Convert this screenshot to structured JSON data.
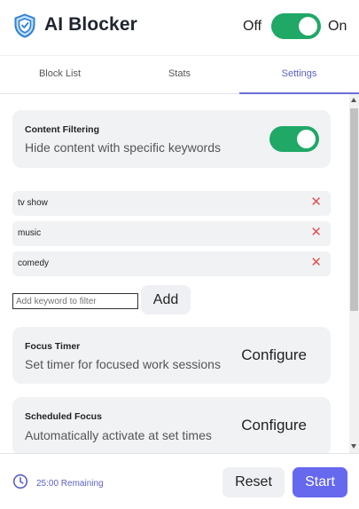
{
  "header": {
    "title": "AI Blocker",
    "off_label": "Off",
    "on_label": "On",
    "enabled": true
  },
  "tabs": [
    {
      "label": "Block List",
      "active": false
    },
    {
      "label": "Stats",
      "active": false
    },
    {
      "label": "Settings",
      "active": true
    }
  ],
  "content_filtering": {
    "title": "Content Filtering",
    "description": "Hide content with specific keywords",
    "enabled": true
  },
  "keywords": [
    {
      "text": "tv show",
      "remove_icon": "close-icon"
    },
    {
      "text": "music",
      "remove_icon": "close-icon"
    },
    {
      "text": "comedy",
      "remove_icon": "close-icon"
    }
  ],
  "keyword_input": {
    "placeholder": "Add keyword to filter",
    "value": ""
  },
  "add_label": "Add",
  "focus_timer": {
    "title": "Focus Timer",
    "description": "Set timer for focused work sessions",
    "button": "Configure"
  },
  "scheduled_focus": {
    "title": "Scheduled Focus",
    "description": "Automatically activate at set times",
    "button": "Configure"
  },
  "footer": {
    "remaining": "25:00 Remaining",
    "reset_label": "Reset",
    "start_label": "Start"
  },
  "colors": {
    "accent": "#6668ee",
    "toggle_on": "#1fa866",
    "remove": "#e05252"
  }
}
